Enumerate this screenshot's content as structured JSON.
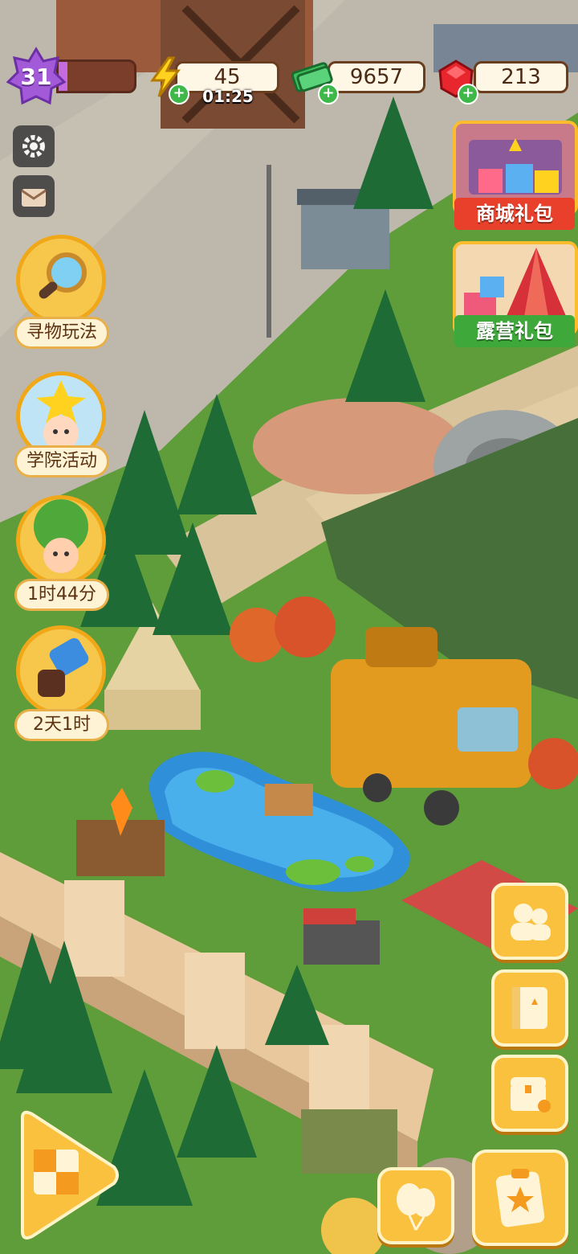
{
  "hud": {
    "level": "31",
    "xp_progress": 0.12,
    "energy": "45",
    "energy_timer": "01:25",
    "cash": "9657",
    "gems": "213"
  },
  "left_menu": {
    "settings_icon": "gear-icon",
    "mail_icon": "envelope-icon",
    "events": [
      {
        "label": "寻物玩法",
        "icon": "magnifier-icon"
      },
      {
        "label": "学院活动",
        "icon": "star-character-icon"
      },
      {
        "label": "1时44分",
        "icon": "tree-character-icon"
      },
      {
        "label": "2天1时",
        "icon": "hammer-icon"
      }
    ]
  },
  "right_menu": {
    "packs": [
      {
        "label": "商城礼包",
        "color": "#e8402a"
      },
      {
        "label": "露营礼包",
        "color": "#3fa83a"
      }
    ],
    "buttons": [
      "characters-icon",
      "book-icon",
      "chest-icon"
    ]
  },
  "bottom": {
    "play_icon": "board-swap-icon",
    "balloon_icon": "balloon-icon",
    "tasks_icon": "clipboard-star-icon"
  },
  "colors": {
    "grass": "#5f9c3a",
    "road": "#b8b3a6",
    "accent_gold": "#f9c13e",
    "panel_border": "#6b3d1f"
  }
}
